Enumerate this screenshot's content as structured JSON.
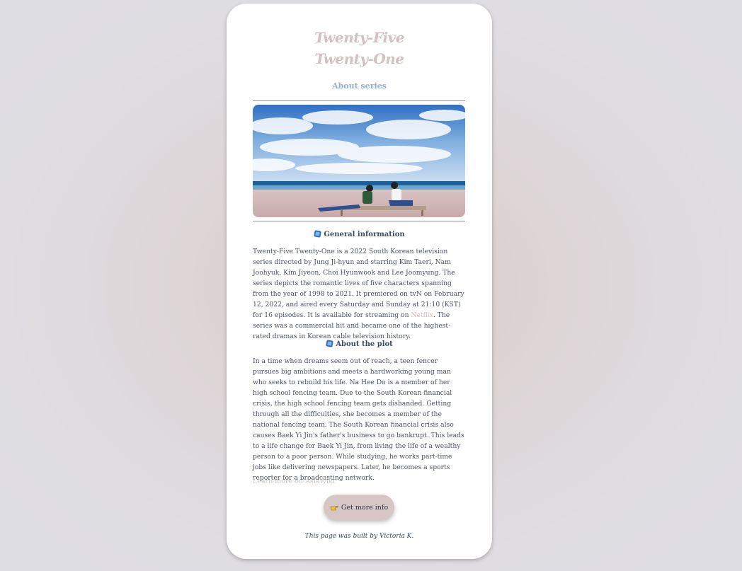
{
  "header": {
    "title_line1": "Twenty-Five",
    "title_line2": "Twenty-One",
    "about_link": "About series"
  },
  "sections": {
    "general_heading": "General information",
    "general_text_1": "Twenty-Five Twenty-One is a 2022 South Korean television series directed by Jung Ji-hyun and starring Kim Taeri, Nam Joohyuk, Kim Jiyeon, Choi Hyunwook and Lee Joomyung. The series depicts the romantic lives of five characters spanning from the year of 1998 to 2021. It premiered on tvN on February 12, 2022, and aired every Saturday and Sunday at 21:10 (KST) for 16 episodes. It is available for streaming on ",
    "netflix_link": "Netflix",
    "general_text_2": ". The series was a commercial hit and became one of the highest-rated dramas in Korean cable television history.",
    "plot_heading": "About the plot",
    "plot_text": "In a time when dreams seem out of reach, a teen fencer pursues big ambitions and meets a hardworking young man who seeks to rebuild his life. Na Hee Do is a member of her high school fencing team. Due to the South Korean financial crisis, the high school fencing team gets disbanded. Getting through all the difficulties, she becomes a member of the national fencing team. The South Korean financial crisis also causes Baek Yi Jin's father's business to go bankrupt. This leads to a life change for Baek Yi Jin, from living the life of a wealthy person to a poor person. While studying, he works part-time jobs like delivering newspapers. Later, he becomes a sports reporter for a broadcasting network.",
    "learn_more": "Learn more on AsiaWiki"
  },
  "cta": {
    "label": "Get more info",
    "icon": "pointing-hand-icon"
  },
  "footer": {
    "credit": "This page was built by Victoria K."
  },
  "colors": {
    "title": "#d3c0c2",
    "about_link": "#8fb1cf",
    "button_bg": "#d7c6c6",
    "text": "#4a5060"
  }
}
